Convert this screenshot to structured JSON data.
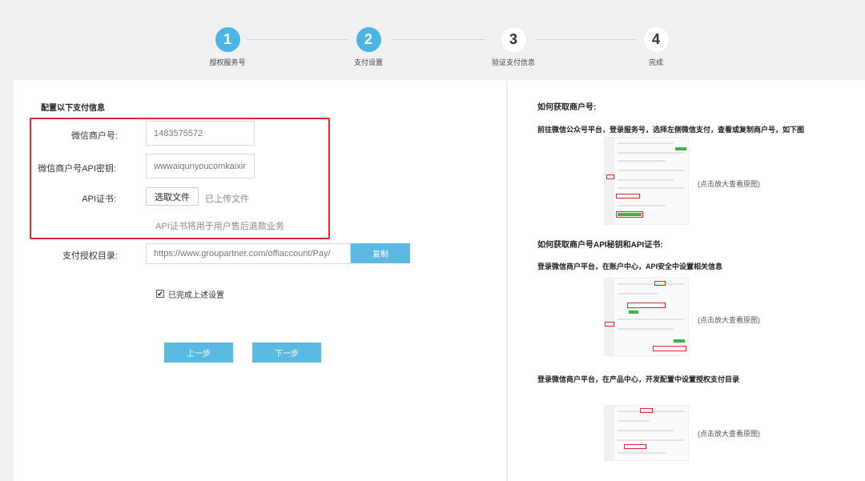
{
  "steps": [
    {
      "number": "1",
      "label": "授权服务号",
      "state": "active"
    },
    {
      "number": "2",
      "label": "支付设置",
      "state": "active"
    },
    {
      "number": "3",
      "label": "验证支付信息",
      "state": "pending"
    },
    {
      "number": "4",
      "label": "完成",
      "state": "pending"
    }
  ],
  "form": {
    "section_title": "配置以下支付信息",
    "merchant_id_label": "微信商户号:",
    "merchant_id_value": "1483575572",
    "api_key_label": "微信商户号API密钥:",
    "api_key_value": "wwwaiqunyoucomkaixir",
    "cert_label": "API证书:",
    "cert_button": "选取文件",
    "cert_status": "已上传文件",
    "cert_note": "API证书将用于用户售后退款业务",
    "pay_dir_label": "支付授权目录:",
    "pay_dir_value": "https://www.groupartner.com/offiaccount/Pay/",
    "copy_button": "复制",
    "checkbox_label": "已完成上述设置",
    "checkbox_checked": true,
    "prev_button": "上一步",
    "next_button": "下一步"
  },
  "help": {
    "heading1": "如何获取商户号:",
    "text1": "前往微信公众号平台，登录服务号，选择左侧微信支付，查看或复制商户号，如下图",
    "heading2": "如何获取商户号API秘钥和API证书:",
    "text2": "登录微信商户平台，在账户中心，API安全中设置相关信息",
    "text3": "登录微信商户平台，在产品中心，开发配置中设置授权支付目录",
    "zoom_hint": "(点击放大查看原图)"
  },
  "colors": {
    "accent": "#4bb4e0",
    "button": "#5bb9e2",
    "highlight_border": "#e3262c"
  }
}
